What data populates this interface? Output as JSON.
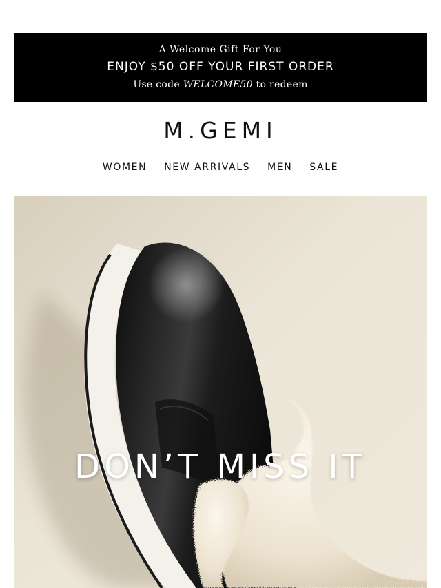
{
  "promo": {
    "eyebrow": "A Welcome Gift For You",
    "headline": "ENJOY $50 OFF YOUR FIRST ORDER",
    "code_prefix": "Use code ",
    "code": "WELCOME50",
    "code_suffix": " to redeem",
    "background": "#000000",
    "text_color": "#ffffff"
  },
  "brand": {
    "logo": "M.GEMI"
  },
  "nav": {
    "items": [
      {
        "label": "WOMEN"
      },
      {
        "label": "NEW ARRIVALS"
      },
      {
        "label": "MEN"
      },
      {
        "label": "SALE"
      }
    ]
  },
  "hero": {
    "heading": "DON’T MISS IT",
    "image": "black-leather-shearling-slip-on-shoe-photo",
    "colors": {
      "wall": "#e9e2d3",
      "leather": "#1a1a1a",
      "shearling": "#efe6d6",
      "sole": "#f4f1ea"
    }
  }
}
